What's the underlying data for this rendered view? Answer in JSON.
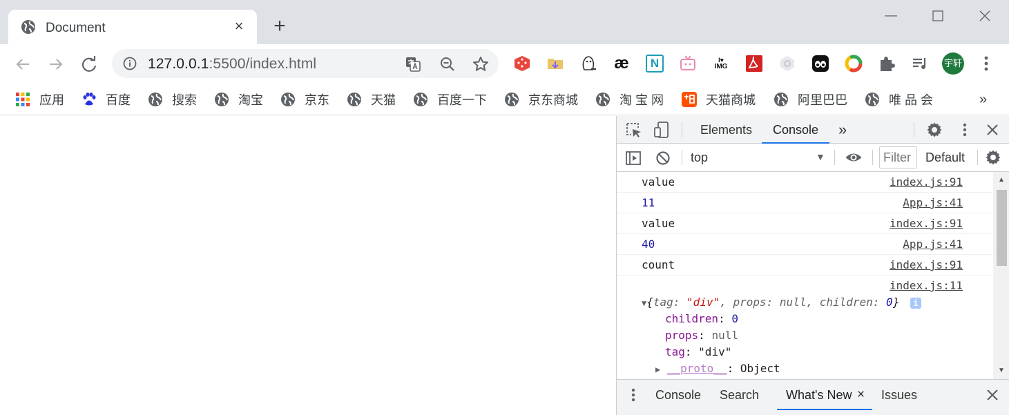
{
  "browser": {
    "tab_title": "Document",
    "url_host": "127.0.0.1",
    "url_rest": ":5500/index.html",
    "avatar_text": "宇轩"
  },
  "extensions": [
    "dice-icon",
    "folder-download-icon",
    "penguin-icon",
    "ae-icon",
    "n-bracket-icon",
    "tv-icon",
    "img-icon",
    "pdf-icon",
    "hexagon-icon",
    "panda-icon",
    "chrome-ring-icon",
    "puzzle-icon",
    "playlist-icon"
  ],
  "ext_labels": {
    "ae": "æ",
    "n": "N",
    "img": "IMG"
  },
  "bookmarks": [
    {
      "label": "应用"
    },
    {
      "label": "百度"
    },
    {
      "label": "搜索"
    },
    {
      "label": "淘宝"
    },
    {
      "label": "京东"
    },
    {
      "label": "天猫"
    },
    {
      "label": "百度一下"
    },
    {
      "label": "京东商城"
    },
    {
      "label": "淘 宝 网"
    },
    {
      "label": "天猫商城"
    },
    {
      "label": "阿里巴巴"
    },
    {
      "label": "唯 品 会"
    }
  ],
  "bookmarks_more": "»",
  "devtools": {
    "tabs": {
      "elements": "Elements",
      "console": "Console",
      "more": "»"
    },
    "context": "top",
    "filter_placeholder": "Filter",
    "levels": "Default",
    "console": [
      {
        "msg": "value",
        "src": "index.js:91"
      },
      {
        "msg": "11",
        "src": "App.js:41"
      },
      {
        "msg": "value",
        "src": "index.js:91"
      },
      {
        "msg": "40",
        "src": "App.js:41"
      },
      {
        "msg": "count",
        "src": "index.js:91"
      },
      {
        "msg": "",
        "src": "index.js:11"
      }
    ],
    "object": {
      "summary_open": "{",
      "tag_key": "tag",
      "tag_val": "\"div\"",
      "props_key": "props",
      "props_val": "null",
      "children_key": "children",
      "children_val": "0",
      "summary_close": "}",
      "info": "i",
      "props": [
        {
          "key": "children",
          "val": "0"
        },
        {
          "key": "props",
          "val": "null"
        },
        {
          "key": "tag",
          "val": "\"div\""
        }
      ],
      "proto_key": "__proto__",
      "proto_val": "Object"
    },
    "drawer": {
      "console": "Console",
      "search": "Search",
      "whatsnew": "What's New",
      "issues": "Issues"
    }
  },
  "colors": {
    "accent": "#1a73e8",
    "tabstrip": "#dee1e6",
    "devtools_bg": "#f1f3f4",
    "console_number": "#1a1aa6",
    "string": "#c41a16",
    "key": "#881391"
  }
}
